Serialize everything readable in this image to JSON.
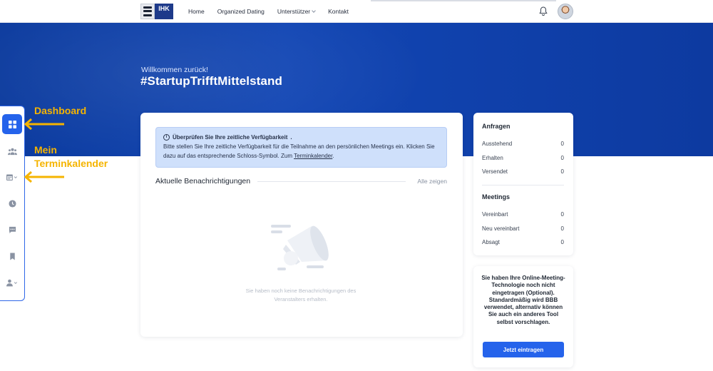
{
  "nav": {
    "logo_text": "IHK",
    "links": [
      "Home",
      "Organized Dating",
      "Unterstützer",
      "Kontakt"
    ]
  },
  "hero": {
    "welcome": "Willkommen zurück!",
    "title": "#StartupTrifftMittelstand"
  },
  "annotations": {
    "dashboard": "Dashboard",
    "calendar_line1": "Mein",
    "calendar_line2": "Terminkalender",
    "color": "#f5b400"
  },
  "sidebar": {
    "items": [
      "dashboard-icon",
      "people-icon",
      "calendar-icon",
      "clock-icon",
      "chat-icon",
      "bookmark-icon",
      "user-icon"
    ],
    "active_color": "#2563eb"
  },
  "alert": {
    "title": "Überprüfen Sie Ihre zeitliche Verfügbarkeit",
    "title_end": ".",
    "body": "Bitte stellen Sie Ihre zeitliche Verfügbarkeit für die Teilnahme an den persönlichen Meetings ein. Klicken Sie dazu auf das entsprechende Schloss-Symbol. Zum ",
    "link": "Terminkalender",
    "body_end": "."
  },
  "notifications": {
    "title": "Aktuelle Benachrichtigungen",
    "show_all": "Alle zeigen",
    "empty_line1": "Sie haben noch keine Benachrichtigungen des",
    "empty_line2": "Veranstalters erhalten."
  },
  "requests": {
    "title": "Anfragen",
    "rows": [
      {
        "label": "Ausstehend",
        "value": "0"
      },
      {
        "label": "Erhalten",
        "value": "0"
      },
      {
        "label": "Versendet",
        "value": "0"
      }
    ]
  },
  "meetings": {
    "title": "Meetings",
    "rows": [
      {
        "label": "Vereinbart",
        "value": "0"
      },
      {
        "label": "Neu vereinbart",
        "value": "0"
      },
      {
        "label": "Absagt",
        "value": "0"
      }
    ]
  },
  "online_meeting": {
    "text": "Sie haben Ihre Online-Meeting-Technologie noch nicht eingetragen (Optional). Standardmäßig wird BBB verwendet, alternativ können Sie auch ein anderes Tool selbst vorschlagen.",
    "button": "Jetzt eintragen"
  },
  "colors": {
    "primary": "#2563eb",
    "hero": "#0d3aa0",
    "alert_bg": "#cfe0fb"
  }
}
